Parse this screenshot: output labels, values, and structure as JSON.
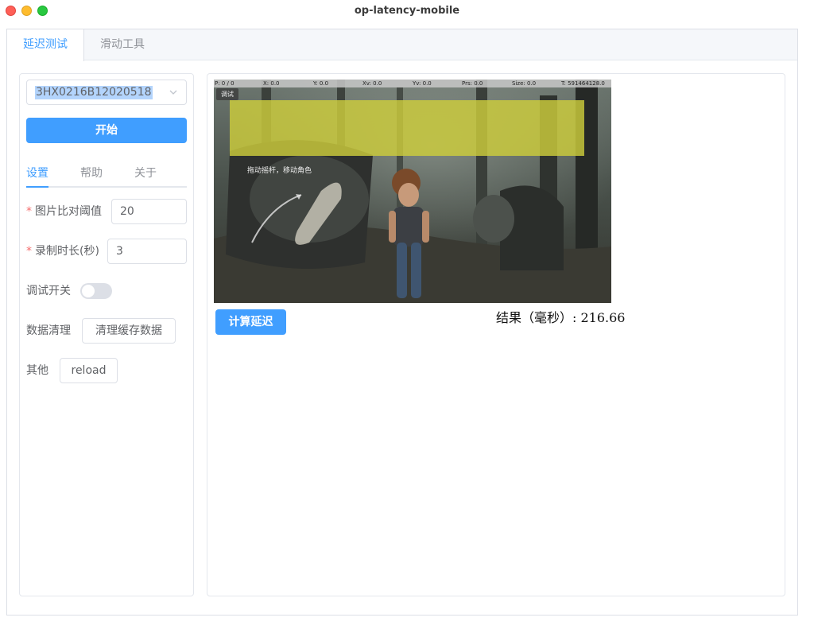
{
  "window": {
    "title": "op-latency-mobile"
  },
  "top_tabs": [
    {
      "label": "延迟测试",
      "active": true
    },
    {
      "label": "滑动工具",
      "active": false
    }
  ],
  "device_select": {
    "value": "3HX0216B12020518"
  },
  "start_button": {
    "label": "开始"
  },
  "sub_tabs": [
    {
      "label": "设置",
      "active": true
    },
    {
      "label": "帮助",
      "active": false
    },
    {
      "label": "关于",
      "active": false
    }
  ],
  "form": {
    "threshold": {
      "label": "图片比对阈值",
      "required": true,
      "value": "20"
    },
    "duration": {
      "label": "录制时长(秒)",
      "required": true,
      "value": "3"
    },
    "debug_switch": {
      "label": "调试开关",
      "on": false
    },
    "data_clear": {
      "label": "数据清理",
      "button_label": "清理缓存数据"
    },
    "other": {
      "label": "其他",
      "button_label": "reload"
    }
  },
  "screenshot": {
    "hud": {
      "p": "P: 0 / 0",
      "x": "X: 0.0",
      "y": "Y: 0.0",
      "xv": "Xv: 0.0",
      "yv": "Yv: 0.0",
      "prs": "Prs: 0.0",
      "size": "Size: 0.0",
      "t": "T: 591464128.0"
    },
    "debug_label": "调试",
    "hint": "拖动摇杆，移动角色"
  },
  "calc_button": {
    "label": "计算延迟"
  },
  "result": {
    "text": "结果（毫秒）: 216.66"
  },
  "colors": {
    "primary": "#409eff",
    "required": "#f56c6c",
    "overlay": "#cdcd3c"
  }
}
